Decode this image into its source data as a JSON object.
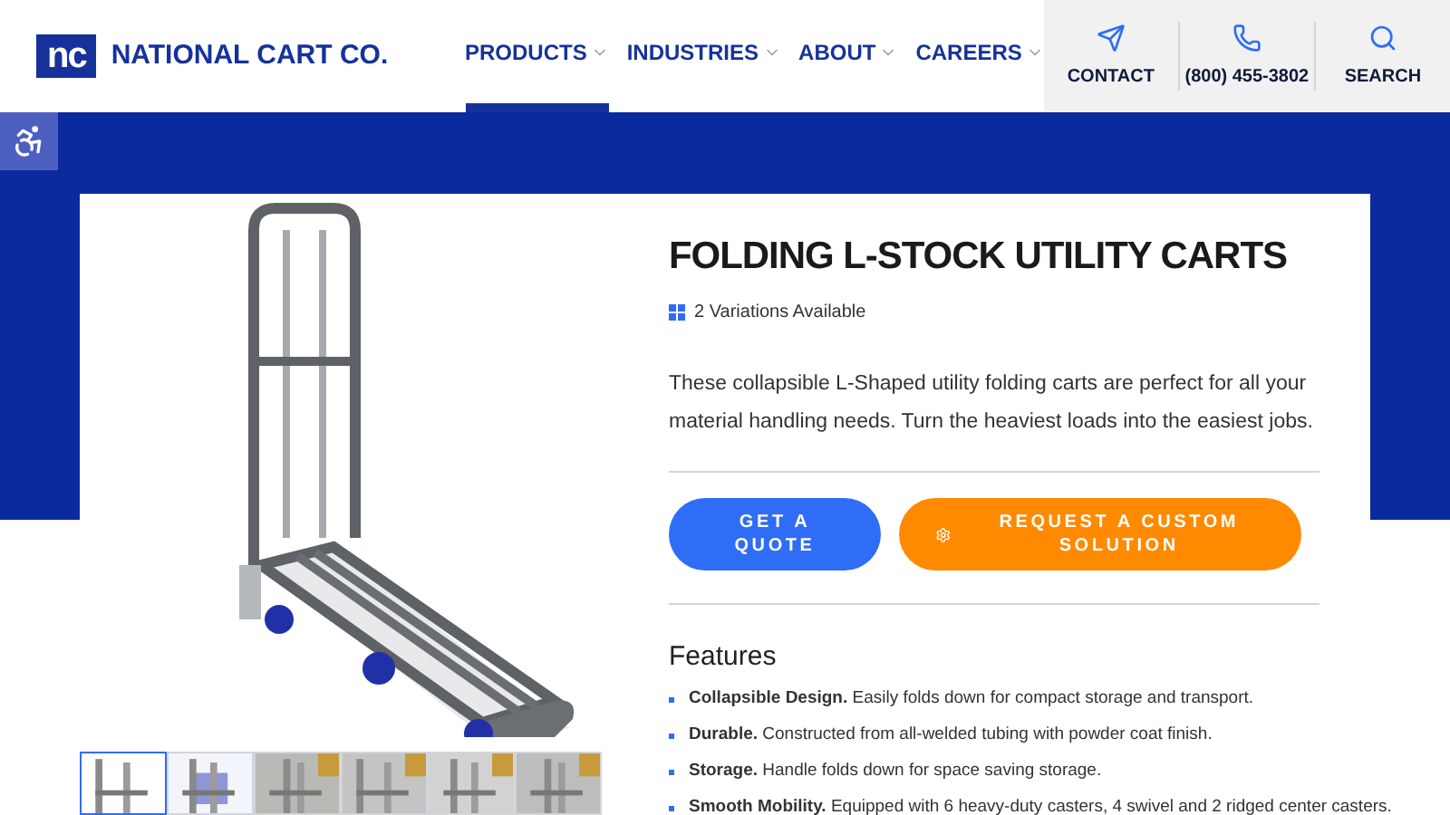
{
  "header": {
    "logo_mark": "nc",
    "brand": "NATIONAL CART CO.",
    "nav": [
      {
        "label": "PRODUCTS",
        "selected": true
      },
      {
        "label": "INDUSTRIES",
        "selected": false
      },
      {
        "label": "ABOUT",
        "selected": false
      },
      {
        "label": "CAREERS",
        "selected": false
      }
    ],
    "actions": [
      {
        "kind": "contact",
        "label": "CONTACT"
      },
      {
        "kind": "phone",
        "label": "(800) 455-3802"
      },
      {
        "kind": "search",
        "label": "SEARCH"
      }
    ]
  },
  "product": {
    "title": "FOLDING L-STOCK UTILITY CARTS",
    "variations": "2 Variations Available",
    "description": "These collapsible L-Shaped utility folding carts are perfect for all your material handling needs. Turn the heaviest loads into the easiest jobs.",
    "buttons": [
      {
        "kind": "quote",
        "label": "GET A QUOTE"
      },
      {
        "kind": "custom",
        "label": "REQUEST A CUSTOM SOLUTION"
      }
    ],
    "features_title": "Features",
    "features": [
      "**Collapsible Design.** Easily folds down for compact storage and transport.",
      "**Durable.** Constructed from all-welded tubing with powder coat finish.",
      "**Storage.** Handle folds down for space saving storage.",
      "**Smooth Mobility.** Equipped with 6 heavy-duty casters, 4 swivel and 2 ridged center casters."
    ],
    "thumbnails": [
      {
        "kind": "picture",
        "selected": true
      },
      {
        "kind": "picture",
        "selected": false
      },
      {
        "kind": "picture",
        "selected": false
      },
      {
        "kind": "picture",
        "selected": false
      },
      {
        "kind": "picture",
        "selected": false
      },
      {
        "kind": "picture",
        "selected": false
      }
    ]
  }
}
